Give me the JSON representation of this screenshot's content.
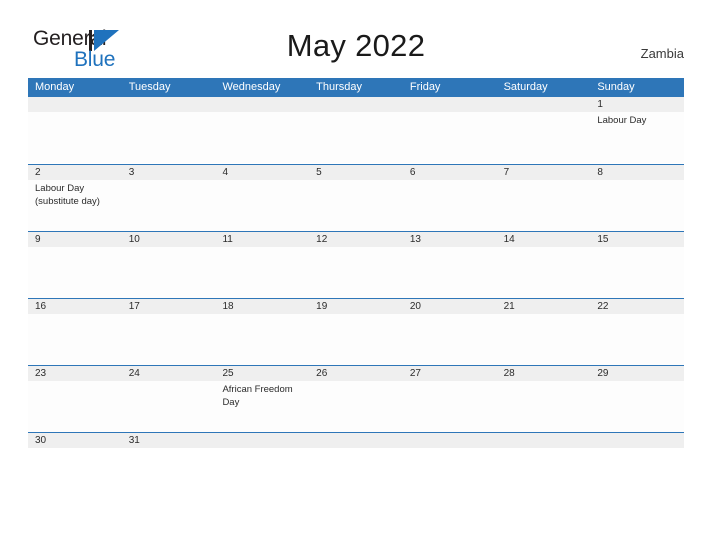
{
  "brand": {
    "name_part1": "General",
    "name_part2": "Blue",
    "mark_icon": "blue-flag-triangle-icon",
    "accent_color": "#1f72bd"
  },
  "header": {
    "title": "May 2022",
    "country": "Zambia"
  },
  "colors": {
    "header_blue": "#2e76b8",
    "row_gray": "#efefef",
    "text_dark": "#2b2b2b"
  },
  "calendar": {
    "weekdays": [
      "Monday",
      "Tuesday",
      "Wednesday",
      "Thursday",
      "Friday",
      "Saturday",
      "Sunday"
    ],
    "weeks": [
      {
        "days": [
          {
            "num": "",
            "events": []
          },
          {
            "num": "",
            "events": []
          },
          {
            "num": "",
            "events": []
          },
          {
            "num": "",
            "events": []
          },
          {
            "num": "",
            "events": []
          },
          {
            "num": "",
            "events": []
          },
          {
            "num": "1",
            "events": [
              "Labour Day"
            ]
          }
        ]
      },
      {
        "days": [
          {
            "num": "2",
            "events": [
              "Labour Day",
              "(substitute day)"
            ]
          },
          {
            "num": "3",
            "events": []
          },
          {
            "num": "4",
            "events": []
          },
          {
            "num": "5",
            "events": []
          },
          {
            "num": "6",
            "events": []
          },
          {
            "num": "7",
            "events": []
          },
          {
            "num": "8",
            "events": []
          }
        ]
      },
      {
        "days": [
          {
            "num": "9",
            "events": []
          },
          {
            "num": "10",
            "events": []
          },
          {
            "num": "11",
            "events": []
          },
          {
            "num": "12",
            "events": []
          },
          {
            "num": "13",
            "events": []
          },
          {
            "num": "14",
            "events": []
          },
          {
            "num": "15",
            "events": []
          }
        ]
      },
      {
        "days": [
          {
            "num": "16",
            "events": []
          },
          {
            "num": "17",
            "events": []
          },
          {
            "num": "18",
            "events": []
          },
          {
            "num": "19",
            "events": []
          },
          {
            "num": "20",
            "events": []
          },
          {
            "num": "21",
            "events": []
          },
          {
            "num": "22",
            "events": []
          }
        ]
      },
      {
        "days": [
          {
            "num": "23",
            "events": []
          },
          {
            "num": "24",
            "events": []
          },
          {
            "num": "25",
            "events": [
              "African Freedom",
              "Day"
            ]
          },
          {
            "num": "26",
            "events": []
          },
          {
            "num": "27",
            "events": []
          },
          {
            "num": "28",
            "events": []
          },
          {
            "num": "29",
            "events": []
          }
        ]
      },
      {
        "days": [
          {
            "num": "30",
            "events": []
          },
          {
            "num": "31",
            "events": []
          },
          {
            "num": "",
            "events": []
          },
          {
            "num": "",
            "events": []
          },
          {
            "num": "",
            "events": []
          },
          {
            "num": "",
            "events": []
          },
          {
            "num": "",
            "events": []
          }
        ]
      }
    ]
  }
}
